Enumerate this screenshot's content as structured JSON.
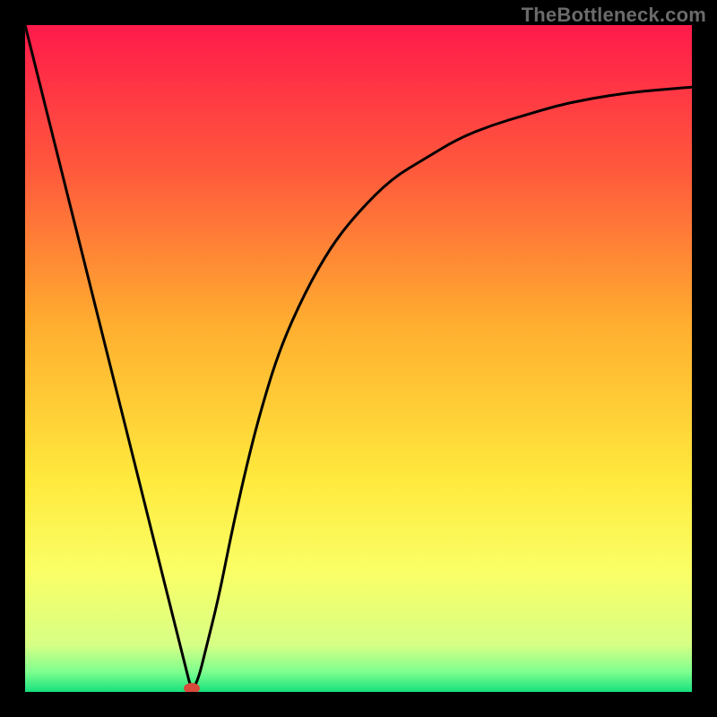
{
  "watermark": "TheBottleneck.com",
  "chart_data": {
    "type": "line",
    "title": "",
    "xlabel": "",
    "ylabel": "",
    "xlim": [
      0,
      100
    ],
    "ylim": [
      0,
      100
    ],
    "grid": false,
    "legend": false,
    "gradient_stops": [
      {
        "pct": 0,
        "color": "#ff1a4b"
      },
      {
        "pct": 22,
        "color": "#ff5a3c"
      },
      {
        "pct": 45,
        "color": "#ffae2f"
      },
      {
        "pct": 68,
        "color": "#ffe93d"
      },
      {
        "pct": 82,
        "color": "#faff66"
      },
      {
        "pct": 93,
        "color": "#d7ff85"
      },
      {
        "pct": 97,
        "color": "#7dff8e"
      },
      {
        "pct": 100,
        "color": "#17e07d"
      }
    ],
    "series": [
      {
        "name": "bottleneck-curve",
        "x": [
          0,
          5,
          10,
          15,
          20,
          22,
          24,
          25,
          26,
          27,
          29,
          31,
          33,
          35,
          38,
          42,
          46,
          50,
          55,
          60,
          65,
          70,
          75,
          80,
          85,
          90,
          95,
          100
        ],
        "y": [
          100,
          80,
          60,
          40,
          20,
          12,
          4,
          0,
          2,
          6,
          14,
          24,
          33,
          41,
          51,
          60,
          67,
          72,
          77,
          80,
          83,
          85,
          86.5,
          88,
          89,
          89.8,
          90.3,
          90.7
        ]
      }
    ],
    "marker": {
      "x": 25,
      "y": 0,
      "color": "#d84a3b"
    }
  }
}
